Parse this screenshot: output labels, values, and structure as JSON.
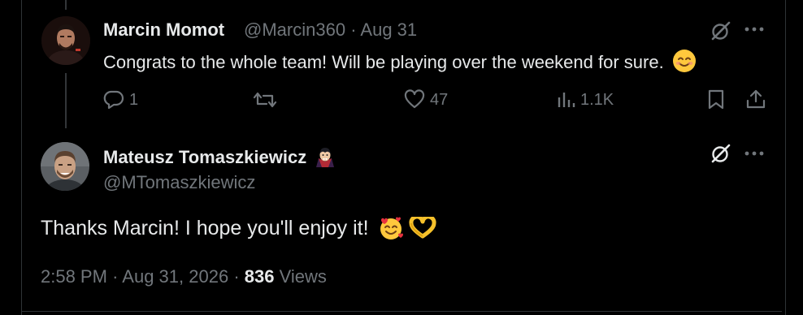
{
  "reply": {
    "author_name": "Marcin Momot",
    "handle": "@Marcin360",
    "separator": "·",
    "date": "Aug 31",
    "text": "Congrats to the whole team! Will be playing over the weekend for sure.",
    "actions": {
      "replies": "1",
      "retweets": "",
      "likes": "47",
      "views": "1.1K"
    }
  },
  "main_tweet": {
    "author_name": "Mateusz Tomaszkiewicz",
    "handle": "@MTomaszkiewicz",
    "text": "Thanks Marcin! I hope you'll enjoy it!",
    "time": "2:58 PM",
    "separator": "·",
    "date": "Aug 31, 2026",
    "views_count": "836",
    "views_label": "Views"
  },
  "icons": {
    "more": "more-horizontal-icon",
    "grok": "grok-slash-icon",
    "reply": "reply-bubble-icon",
    "retweet": "retweet-icon",
    "like": "heart-icon",
    "views": "bar-chart-icon",
    "bookmark": "bookmark-icon",
    "share": "share-upload-icon",
    "emoji_smile": "smiling-face-emoji",
    "emoji_vampire": "vampire-emoji",
    "emoji_hearts": "smiling-face-with-hearts-emoji",
    "emoji_heart_hands": "heart-hands-emoji"
  },
  "colors": {
    "background": "#000000",
    "text_primary": "#e7e9ea",
    "text_secondary": "#71767b",
    "divider": "#2f3336"
  }
}
